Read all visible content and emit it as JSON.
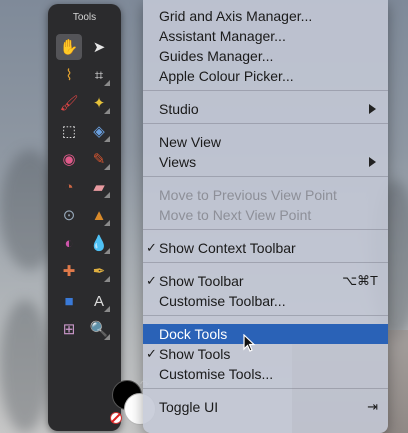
{
  "tools_panel": {
    "title": "Tools",
    "tools": [
      {
        "name": "hand-tool",
        "glyph": "✋",
        "active": true
      },
      {
        "name": "move-tool",
        "glyph": "➤"
      },
      {
        "name": "eyedropper-tool",
        "glyph": "⌇"
      },
      {
        "name": "crop-tool",
        "glyph": "⌗"
      },
      {
        "name": "brush-tool",
        "glyph": "🖌"
      },
      {
        "name": "magic-wand-tool",
        "glyph": "✦"
      },
      {
        "name": "selection-tool",
        "glyph": "⬚"
      },
      {
        "name": "fill-tool",
        "glyph": "◈"
      },
      {
        "name": "color-tool",
        "glyph": "◉"
      },
      {
        "name": "paint-brush-tool",
        "glyph": "✎"
      },
      {
        "name": "color-replace-tool",
        "glyph": "◔"
      },
      {
        "name": "eraser-tool",
        "glyph": "▰"
      },
      {
        "name": "zoom-lens-tool",
        "glyph": "⊙"
      },
      {
        "name": "stamp-tool",
        "glyph": "▲"
      },
      {
        "name": "dodge-tool",
        "glyph": "◐"
      },
      {
        "name": "blur-tool",
        "glyph": "💧"
      },
      {
        "name": "healing-tool",
        "glyph": "✚"
      },
      {
        "name": "pen-tool",
        "glyph": "✒"
      },
      {
        "name": "rectangle-tool",
        "glyph": "■"
      },
      {
        "name": "text-tool",
        "glyph": "A"
      },
      {
        "name": "mesh-tool",
        "glyph": "⊞"
      },
      {
        "name": "zoom-tool",
        "glyph": "🔍"
      }
    ]
  },
  "menu": {
    "items": [
      {
        "label": "Grid and Axis Manager..."
      },
      {
        "label": "Assistant Manager..."
      },
      {
        "label": "Guides Manager..."
      },
      {
        "label": "Apple Colour Picker..."
      },
      {
        "label": "Studio",
        "submenu": true
      },
      {
        "label": "New View"
      },
      {
        "label": "Views",
        "submenu": true
      },
      {
        "label": "Move to Previous View Point",
        "disabled": true
      },
      {
        "label": "Move to Next View Point",
        "disabled": true
      },
      {
        "label": "Show Context Toolbar",
        "checked": true
      },
      {
        "label": "Show Toolbar",
        "checked": true,
        "shortcut": "⌥⌘T"
      },
      {
        "label": "Customise Toolbar..."
      },
      {
        "label": "Dock Tools",
        "highlighted": true
      },
      {
        "label": "Show Tools",
        "checked": true
      },
      {
        "label": "Customise Tools..."
      },
      {
        "label": "Toggle UI",
        "shortcut": "⇥"
      }
    ],
    "check_glyph": "✓"
  },
  "colors": {
    "highlight": "#2a62b7",
    "panel": "#2b2b2d"
  }
}
